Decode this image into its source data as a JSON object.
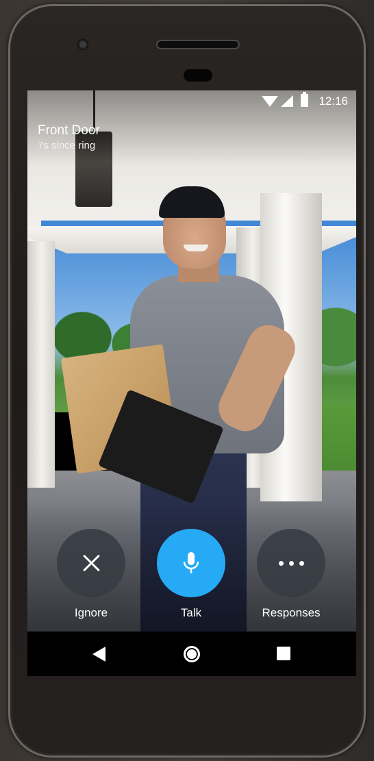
{
  "status_bar": {
    "time": "12:16",
    "icons": [
      "wifi-icon",
      "signal-icon",
      "battery-icon"
    ]
  },
  "camera": {
    "title": "Front Door",
    "subtitle": "7s since ring"
  },
  "actions": [
    {
      "label": "Ignore",
      "icon": "close-icon"
    },
    {
      "label": "Talk",
      "icon": "microphone-icon"
    },
    {
      "label": "Responses",
      "icon": "more-dots-icon"
    }
  ],
  "colors": {
    "talk_accent": "#27aaf5",
    "action_dark": "#373c44"
  },
  "nav_bar": {
    "icons": [
      "back-icon",
      "home-icon",
      "recents-icon"
    ]
  }
}
